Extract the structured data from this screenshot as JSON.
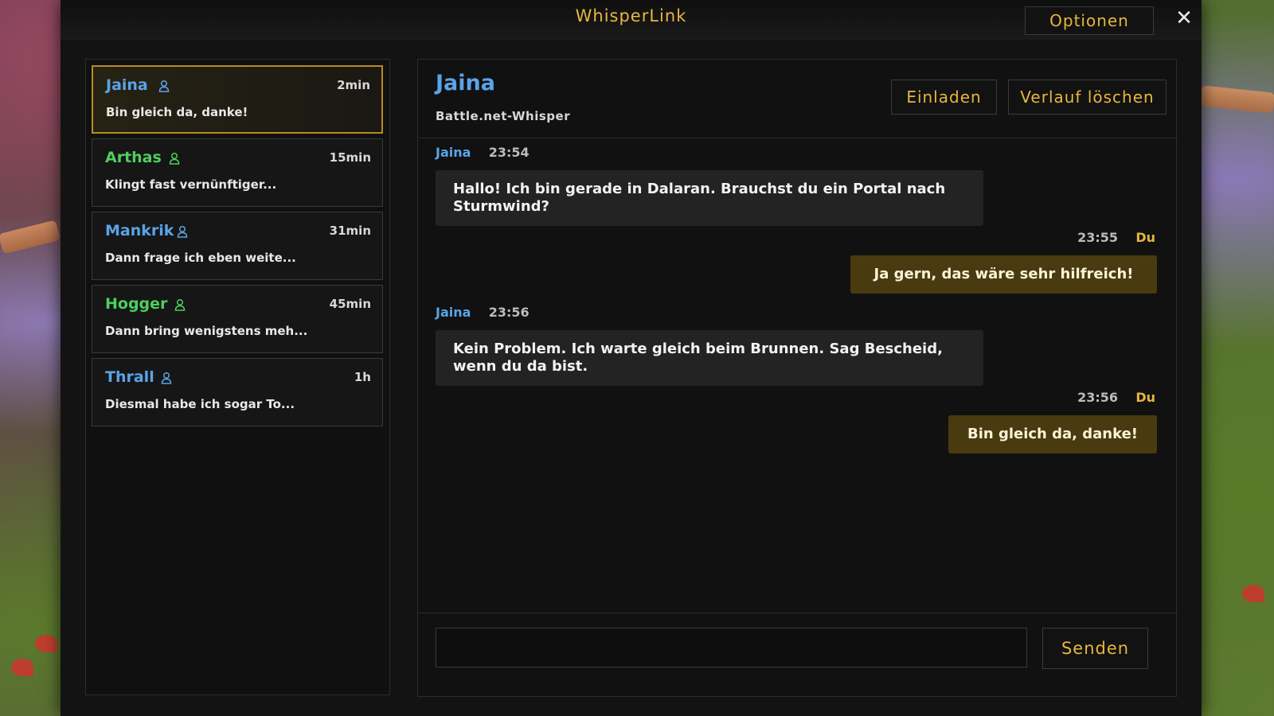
{
  "window": {
    "title": "WhisperLink",
    "options_label": "Optionen",
    "close_symbol": "✕"
  },
  "colors": {
    "accent": "#e7b640",
    "blue_name": "#5aa4e8",
    "green_name": "#4ecf5e",
    "active_border": "#b98b22"
  },
  "conversations": [
    {
      "name": "Jaina",
      "time": "2min",
      "preview": "Bin gleich da, danke!",
      "name_color": "#5aa4e8",
      "active": true
    },
    {
      "name": "Arthas",
      "time": "15min",
      "preview": "Klingt fast vernünftiger...",
      "name_color": "#4ecf5e",
      "active": false
    },
    {
      "name": "Mankrik",
      "time": "31min",
      "preview": "Dann frage ich eben weite...",
      "name_color": "#5aa4e8",
      "active": false
    },
    {
      "name": "Hogger",
      "time": "45min",
      "preview": "Dann bring wenigstens meh...",
      "name_color": "#4ecf5e",
      "active": false
    },
    {
      "name": "Thrall",
      "time": "1h",
      "preview": "Diesmal habe ich sogar To...",
      "name_color": "#5aa4e8",
      "active": false
    }
  ],
  "chat": {
    "contact_name": "Jaina",
    "contact_subtitle": "Battle.net-Whisper",
    "invite_label": "Einladen",
    "clear_label": "Verlauf löschen",
    "messages": [
      {
        "sender": "Jaina",
        "time": "23:54",
        "text": "Hallo! Ich bin gerade in Dalaran. Brauchst du ein Portal nach Sturmwind?"
      },
      {
        "sender": "Du",
        "time": "23:55",
        "text": "Ja gern, das wäre sehr hilfreich!"
      },
      {
        "sender": "Jaina",
        "time": "23:56",
        "text": "Kein Problem. Ich warte gleich beim Brunnen. Sag Bescheid, wenn du da bist."
      },
      {
        "sender": "Du",
        "time": "23:56",
        "text": "Bin gleich da, danke!"
      }
    ]
  },
  "composer": {
    "value": "",
    "send_label": "Senden"
  }
}
